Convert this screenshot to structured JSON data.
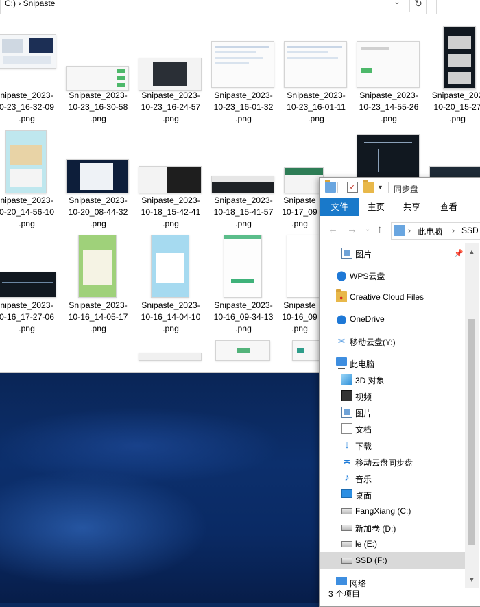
{
  "background_window": {
    "address_path": "C:) › Snipaste",
    "files_row1": [
      {
        "name": "nipaste_2023-\n0-23_16-32-09\n.png"
      },
      {
        "name": "Snipaste_2023-\n10-23_16-30-58\n.png"
      },
      {
        "name": "Snipaste_2023-\n10-23_16-24-57\n.png"
      },
      {
        "name": "Snipaste_2023-\n10-23_16-01-32\n.png"
      },
      {
        "name": "Snipaste_2023-\n10-23_16-01-11\n.png"
      },
      {
        "name": "Snipaste_2023-\n10-23_14-55-26\n.png"
      },
      {
        "name": "Snipaste_202\n10-20_15-27\n.png"
      }
    ],
    "files_row2": [
      {
        "name": "nipaste_2023-\n0-20_14-56-10\n.png"
      },
      {
        "name": "Snipaste_2023-\n10-20_08-44-32\n.png"
      },
      {
        "name": "Snipaste_2023-\n10-18_15-42-41\n.png"
      },
      {
        "name": "Snipaste_2023-\n10-18_15-41-57\n.png"
      },
      {
        "name": "Snipaste\n10-17_09\n.png"
      }
    ],
    "files_row3": [
      {
        "name": "nipaste_2023-\n0-16_17-27-06\n.png"
      },
      {
        "name": "Snipaste_2023-\n10-16_14-05-17\n.png"
      },
      {
        "name": "Snipaste_2023-\n10-16_14-04-10\n.png"
      },
      {
        "name": "Snipaste_2023-\n10-16_09-34-13\n.png"
      },
      {
        "name": "Snipaste\n10-16_09\n.png"
      }
    ]
  },
  "foreground_window": {
    "title": "同步盘",
    "ribbon_tabs": [
      "文件",
      "主页",
      "共享",
      "查看"
    ],
    "breadcrumb": [
      "此电脑",
      "SSD"
    ],
    "tree": [
      {
        "label": "图片",
        "icon": "pictures-icon",
        "pinned": true
      },
      {
        "label": "WPS云盘",
        "icon": "wps-cloud-icon"
      },
      {
        "label": "Creative Cloud Files",
        "icon": "creative-cloud-icon"
      },
      {
        "label": "OneDrive",
        "icon": "onedrive-icon"
      },
      {
        "label": "移动云盘(Y:)",
        "icon": "mobile-cloud-drive-icon"
      },
      {
        "label": "此电脑",
        "icon": "this-pc-icon"
      },
      {
        "label": "3D 对象",
        "icon": "3d-objects-icon"
      },
      {
        "label": "视频",
        "icon": "videos-icon"
      },
      {
        "label": "图片",
        "icon": "pictures-icon"
      },
      {
        "label": "文档",
        "icon": "documents-icon"
      },
      {
        "label": "下载",
        "icon": "downloads-icon"
      },
      {
        "label": "移动云盘同步盘",
        "icon": "mobile-cloud-sync-icon"
      },
      {
        "label": "音乐",
        "icon": "music-icon"
      },
      {
        "label": "桌面",
        "icon": "desktop-icon"
      },
      {
        "label": "FangXiang (C:)",
        "icon": "drive-icon"
      },
      {
        "label": "新加卷 (D:)",
        "icon": "drive-icon"
      },
      {
        "label": "le (E:)",
        "icon": "drive-icon"
      },
      {
        "label": "SSD (F:)",
        "icon": "drive-icon",
        "selected": true
      },
      {
        "label": "网络",
        "icon": "network-icon"
      }
    ],
    "status": "3 个项目"
  },
  "colors": {
    "ribbon_file_tab": "#1979ca",
    "selected_row": "#d9d9d9",
    "desktop": "#0b2a5e"
  }
}
